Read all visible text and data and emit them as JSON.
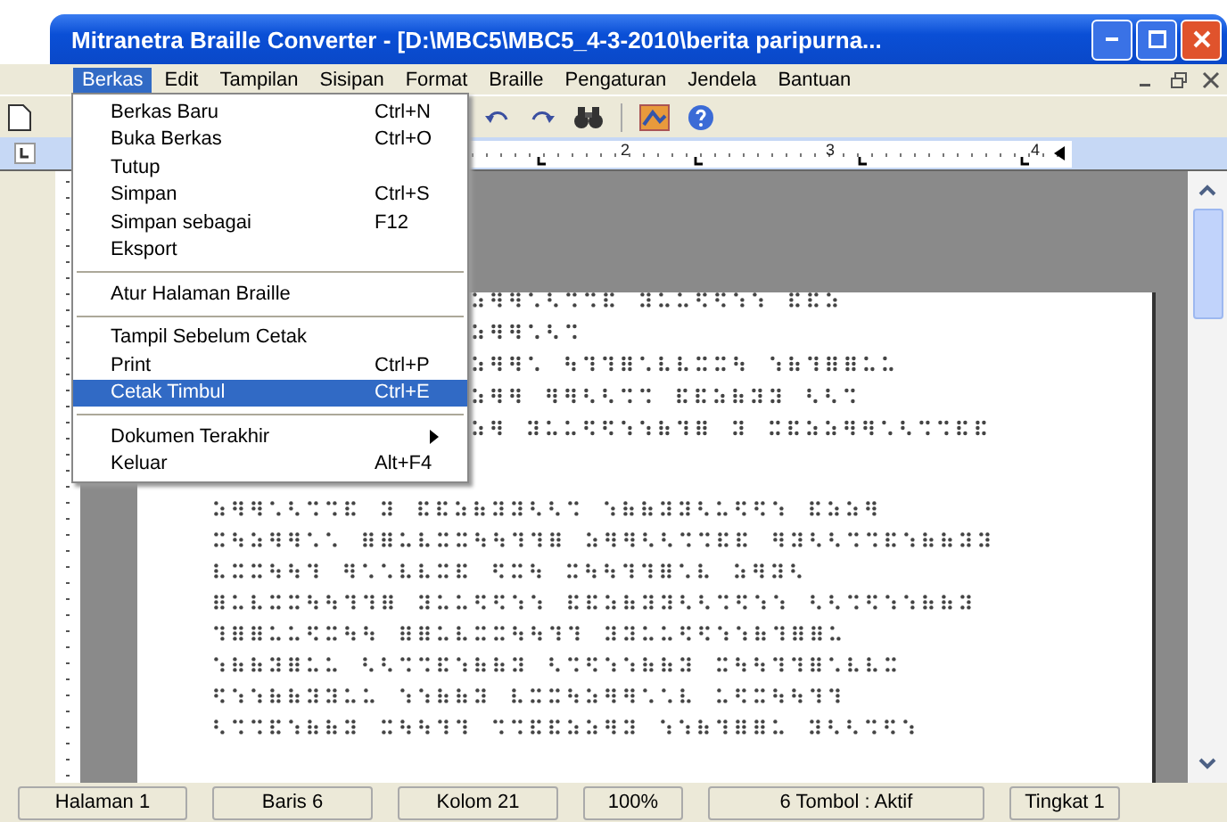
{
  "window": {
    "title": "Mitranetra Braille Converter - [D:\\MBC5\\MBC5_4-3-2010\\berita paripurna..."
  },
  "menu_bar": [
    {
      "label": "Berkas",
      "selected": true
    },
    {
      "label": "Edit",
      "selected": false
    },
    {
      "label": "Tampilan",
      "selected": false
    },
    {
      "label": "Sisipan",
      "selected": false
    },
    {
      "label": "Format",
      "selected": false
    },
    {
      "label": "Braille",
      "selected": false
    },
    {
      "label": "Pengaturan",
      "selected": false
    },
    {
      "label": "Jendela",
      "selected": false
    },
    {
      "label": "Bantuan",
      "selected": false
    }
  ],
  "dropdown": {
    "items": [
      {
        "kind": "item",
        "label": "Berkas Baru",
        "shortcut": "Ctrl+N",
        "selected": false
      },
      {
        "kind": "item",
        "label": "Buka Berkas",
        "shortcut": "Ctrl+O",
        "selected": false
      },
      {
        "kind": "item",
        "label": "Tutup",
        "selected": false
      },
      {
        "kind": "item",
        "label": "Simpan",
        "shortcut": "Ctrl+S",
        "selected": false
      },
      {
        "kind": "item",
        "label": "Simpan sebagai",
        "shortcut": "F12",
        "selected": false
      },
      {
        "kind": "item",
        "label": "Eksport",
        "selected": false
      },
      {
        "kind": "separator"
      },
      {
        "kind": "item",
        "label": "Atur Halaman Braille",
        "selected": false
      },
      {
        "kind": "separator"
      },
      {
        "kind": "item",
        "label": "Tampil Sebelum Cetak",
        "selected": false
      },
      {
        "kind": "item",
        "label": "Print",
        "shortcut": "Ctrl+P",
        "selected": false
      },
      {
        "kind": "item",
        "label": "Cetak Timbul",
        "shortcut": "Ctrl+E",
        "selected": true
      },
      {
        "kind": "separator"
      },
      {
        "kind": "submenu",
        "label": "Dokumen Terakhir",
        "selected": false
      },
      {
        "kind": "item",
        "label": "Keluar",
        "shortcut": "Alt+F4",
        "selected": false
      }
    ]
  },
  "ruler": {
    "numbers": [
      "2",
      "3",
      "4"
    ]
  },
  "status_bar": [
    "Halaman 1",
    "Baris 6",
    "Kolom 21",
    "100%",
    "6 Tombol : Aktif",
    "Tingkat 1"
  ]
}
